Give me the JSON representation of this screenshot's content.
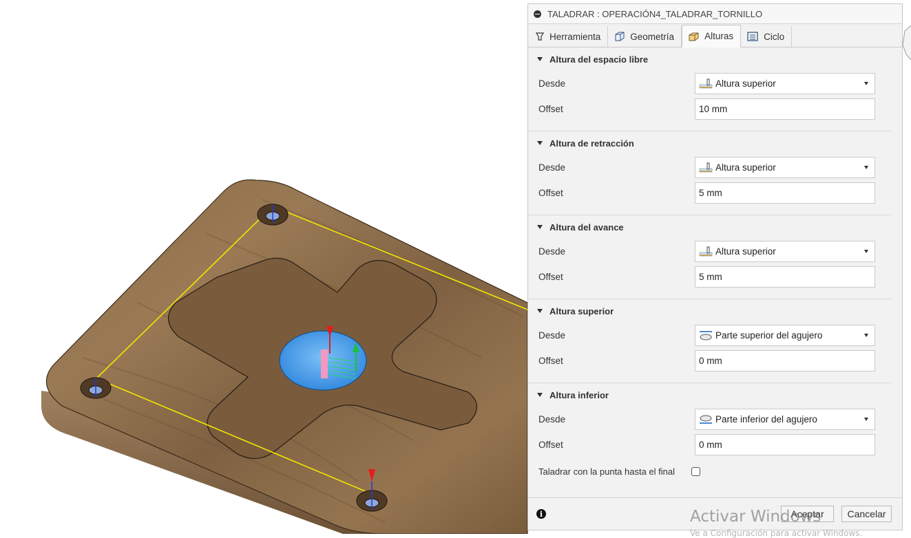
{
  "dialog": {
    "title": "TALADRAR : OPERACIÓN4_TALADRAR_TORNILLO",
    "tabs": [
      {
        "label": "Herramienta",
        "icon": "drill-tool-icon",
        "active": false
      },
      {
        "label": "Geometría",
        "icon": "geometry-icon",
        "active": false
      },
      {
        "label": "Alturas",
        "icon": "heights-icon",
        "active": true
      },
      {
        "label": "Ciclo",
        "icon": "cycle-icon",
        "active": false
      }
    ],
    "sections": [
      {
        "title": "Altura del espacio libre",
        "from_label": "Desde",
        "from_value": "Altura superior",
        "from_icon": "top-height-icon",
        "offset_label": "Offset",
        "offset_value": "10 mm"
      },
      {
        "title": "Altura de retracción",
        "from_label": "Desde",
        "from_value": "Altura superior",
        "from_icon": "top-height-icon",
        "offset_label": "Offset",
        "offset_value": "5 mm"
      },
      {
        "title": "Altura del avance",
        "from_label": "Desde",
        "from_value": "Altura superior",
        "from_icon": "top-height-icon",
        "offset_label": "Offset",
        "offset_value": "5 mm"
      },
      {
        "title": "Altura superior",
        "from_label": "Desde",
        "from_value": "Parte superior del agujero",
        "from_icon": "hole-top-icon",
        "offset_label": "Offset",
        "offset_value": "0 mm"
      },
      {
        "title": "Altura inferior",
        "from_label": "Desde",
        "from_value": "Parte inferior del agujero",
        "from_icon": "hole-bottom-icon",
        "offset_label": "Offset",
        "offset_value": "0 mm"
      }
    ],
    "drill_tip_label": "Taladrar con la punta hasta el final",
    "drill_tip_checked": false,
    "ok_label": "Aceptar",
    "cancel_label": "Cancelar"
  },
  "watermark": {
    "line1": "Activar Windows",
    "line2": "Ve a Configuración para activar Windows."
  },
  "colors": {
    "wood": "#8b6a45",
    "hole_fill": "#3d98e8",
    "toolpath": "#f2e600",
    "axis_z_red": "#e51c1c",
    "axis_green": "#18c23a"
  }
}
